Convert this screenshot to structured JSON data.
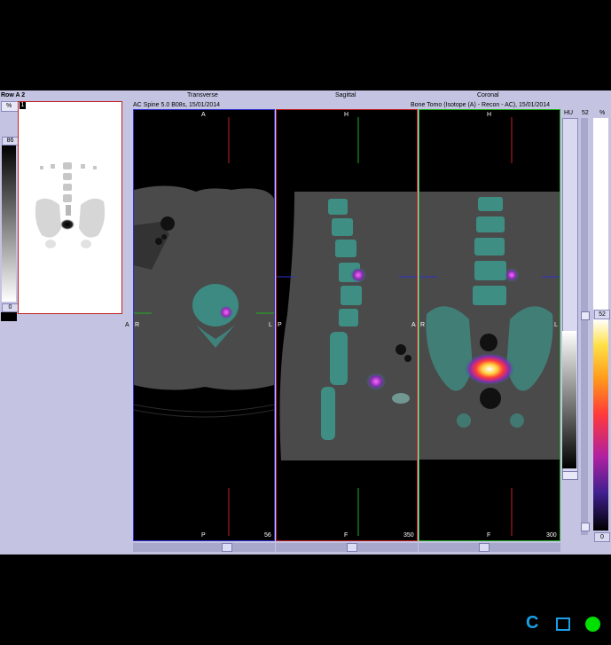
{
  "row_label": "Row A 2",
  "mip": {
    "percent_label": "%",
    "frame_number": "1",
    "max_value": "86",
    "min_value": "0",
    "side_marker": "A"
  },
  "views": {
    "series_info_left": "AC  Spine  5.0  B08s, 15/01/2014",
    "series_info_right": "Bone Tomo (Isotope  (A) - Recon - AC), 15/01/2014",
    "transverse": {
      "title": "Transverse",
      "top": "A",
      "bottom": "P",
      "left": "R",
      "right": "L",
      "slice": "56"
    },
    "sagittal": {
      "title": "Sagittal",
      "top": "H",
      "bottom": "F",
      "left": "P",
      "right": "A",
      "slice": "350"
    },
    "coronal": {
      "title": "Coronal",
      "top": "H",
      "bottom": "F",
      "left": "R",
      "right": "L",
      "slice": "300"
    }
  },
  "colorbars": {
    "hu_label": "HU",
    "hu_value": "52",
    "pct_label": "%",
    "pct_value": "52",
    "bottom_value": "0"
  },
  "toolbar": {
    "refresh_glyph": "C",
    "frame_glyph": "□"
  },
  "colors": {
    "panel": "#c4c4e2",
    "transverse_border": "#3030d0",
    "sagittal_border": "#c02020",
    "coronal_border": "#20b020",
    "status_green": "#00e000",
    "refresh_blue": "#1aa0e8"
  }
}
